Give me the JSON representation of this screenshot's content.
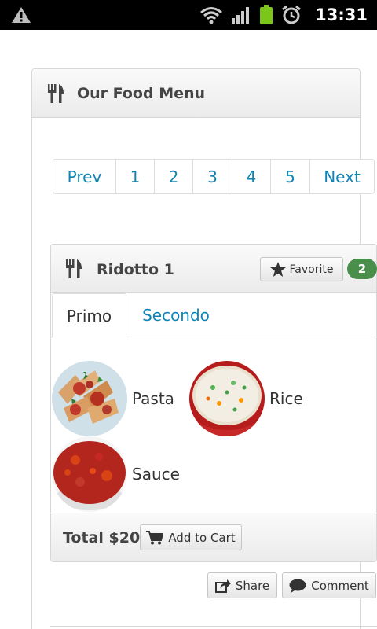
{
  "status_bar": {
    "time": "13:31"
  },
  "menu": {
    "title": "Our Food Menu"
  },
  "pagination": {
    "items": [
      "Prev",
      "1",
      "2",
      "3",
      "4",
      "5",
      "Next"
    ]
  },
  "card": {
    "title": "Ridotto 1",
    "favorite_label": "Favorite",
    "favorite_count": "2",
    "tabs": [
      {
        "label": "Primo",
        "active": true
      },
      {
        "label": "Secondo",
        "active": false
      }
    ],
    "foods": [
      {
        "name": "Pasta",
        "icon": "pasta-image"
      },
      {
        "name": "Rice",
        "icon": "rice-image"
      },
      {
        "name": "Sauce",
        "icon": "sauce-image"
      }
    ],
    "total": "Total $20",
    "add_to_cart_label": "Add to Cart"
  },
  "actions": {
    "share_label": "Share",
    "comment_label": "Comment"
  },
  "colors": {
    "link": "#0e84b5",
    "badge": "#4a8e4c"
  }
}
